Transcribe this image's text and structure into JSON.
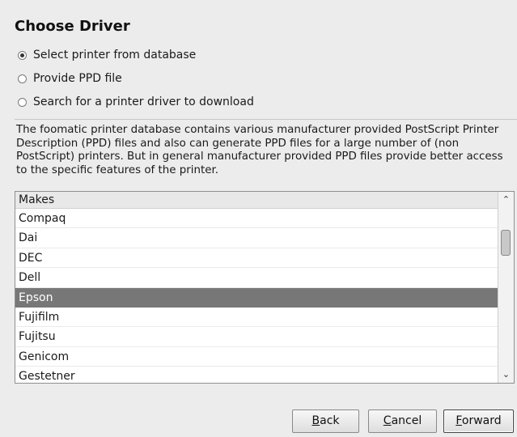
{
  "dialog": {
    "title": "Choose Driver"
  },
  "options": [
    {
      "label": "Select printer from database",
      "checked": true
    },
    {
      "label": "Provide PPD file",
      "checked": false
    },
    {
      "label": "Search for a printer driver to download",
      "checked": false
    }
  ],
  "description": "The foomatic printer database contains various manufacturer provided PostScript Printer Description (PPD) files and also can generate PPD files for a large number of (non PostScript) printers. But in general manufacturer provided PPD files provide better access to the specific features of the printer.",
  "makes": {
    "header": "Makes",
    "items": [
      "Compaq",
      "Dai",
      "DEC",
      "Dell",
      "Epson",
      "Fujifilm",
      "Fujitsu",
      "Genicom",
      "Gestetner"
    ],
    "selected": "Epson"
  },
  "buttons": {
    "back": {
      "mnemonic": "B",
      "rest": "ack"
    },
    "cancel": {
      "mnemonic": "C",
      "rest": "ancel"
    },
    "forward": {
      "mnemonic": "F",
      "rest": "orward"
    }
  }
}
